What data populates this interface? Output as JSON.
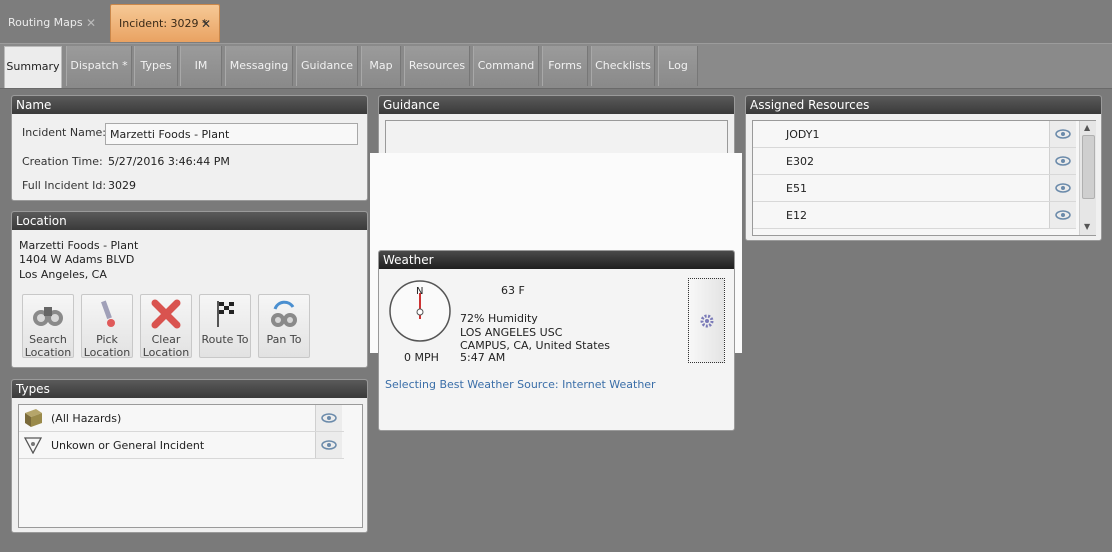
{
  "doc_tabs": [
    {
      "label": "Routing Maps"
    },
    {
      "label": "Incident: 3029 *"
    }
  ],
  "nav_tabs": [
    "Summary",
    "Dispatch *",
    "Types",
    "IM",
    "Messaging",
    "Guidance",
    "Map",
    "Resources",
    "Command",
    "Forms",
    "Checklists",
    "Log"
  ],
  "name_panel": {
    "title": "Name",
    "incident_name_label": "Incident Name:",
    "incident_name_value": "Marzetti Foods - Plant",
    "creation_time_label": "Creation Time:",
    "creation_time_value": "5/27/2016 3:46:44 PM",
    "full_id_label": "Full Incident Id:",
    "full_id_value": "3029"
  },
  "location_panel": {
    "title": "Location",
    "line1": "Marzetti Foods - Plant",
    "line2": "1404 W Adams BLVD",
    "line3": "Los Angeles, CA",
    "buttons": [
      {
        "line1": "Search",
        "line2": "Location",
        "icon": "binoculars-icon"
      },
      {
        "line1": "Pick",
        "line2": "Location",
        "icon": "pick-pin-icon"
      },
      {
        "line1": "Clear",
        "line2": "Location",
        "icon": "clear-x-icon"
      },
      {
        "line1": "Route To",
        "line2": "",
        "icon": "checkered-flag-icon"
      },
      {
        "line1": "Pan To",
        "line2": "",
        "icon": "pan-binoculars-icon"
      }
    ]
  },
  "types_panel": {
    "title": "Types",
    "rows": [
      {
        "label": "(All Hazards)",
        "icon": "book-icon"
      },
      {
        "label": "Unkown or General Incident",
        "icon": "triangle-badge-icon"
      }
    ]
  },
  "guidance_panel": {
    "title": "Guidance"
  },
  "weather_panel": {
    "title": "Weather",
    "compass_letter": "N",
    "temperature": "63 F",
    "humidity": "72% Humidity",
    "station_line1": "LOS ANGELES USC",
    "station_line2": "CAMPUS, CA, United States",
    "time": "5:47 AM",
    "wind": "0 MPH",
    "source": "Selecting Best Weather Source: Internet Weather"
  },
  "resources_panel": {
    "title": "Assigned Resources",
    "rows": [
      "JODY1",
      "E302",
      "E51",
      "E12"
    ]
  },
  "colors": {
    "accent_tab": "#e9a262",
    "header_dark": "#3a3a3a",
    "link_blue": "#3a6ea8",
    "clear_red": "#d9534f"
  }
}
